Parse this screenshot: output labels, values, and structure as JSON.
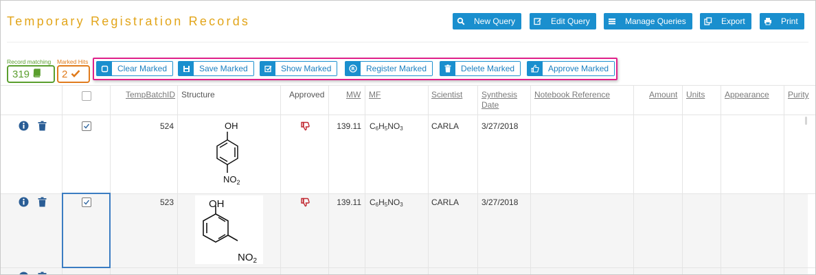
{
  "page": {
    "title": "Temporary Registration Records"
  },
  "toolbar": {
    "new_query": "New Query",
    "edit_query": "Edit Query",
    "manage_queries": "Manage Queries",
    "export": "Export",
    "print": "Print"
  },
  "summary": {
    "record_caption": "Record matching",
    "record_count": "319",
    "marked_caption": "Marked Hits",
    "marked_count": "2"
  },
  "marked_actions": {
    "clear": "Clear Marked",
    "save": "Save Marked",
    "show": "Show Marked",
    "register": "Register Marked",
    "delete": "Delete Marked",
    "approve": "Approve Marked"
  },
  "table": {
    "headers": {
      "temp_batch_id": "TempBatchID",
      "structure": "Structure",
      "approved": "Approved",
      "mw": "MW",
      "mf": "MF",
      "scientist": "Scientist",
      "synthesis_date_1": "Synthesis",
      "synthesis_date_2": "Date",
      "notebook_reference": "Notebook Reference",
      "amount": "Amount",
      "units": "Units",
      "appearance": "Appearance",
      "purity": "Purity"
    },
    "rows": [
      {
        "temp_batch_id": "524",
        "approved": "not-approved",
        "mw": "139.11",
        "mf_c": "C",
        "mf_c_n": "6",
        "mf_h": "H",
        "mf_h_n": "5",
        "mf_rest": "NO",
        "mf_o_n": "3",
        "scientist": "CARLA",
        "synthesis_date": "3/27/2018",
        "checked": true,
        "structure_oh": "OH",
        "structure_no2": "NO",
        "structure_no2_sub": "2"
      },
      {
        "temp_batch_id": "523",
        "approved": "not-approved",
        "mw": "139.11",
        "mf_c": "C",
        "mf_c_n": "6",
        "mf_h": "H",
        "mf_h_n": "5",
        "mf_rest": "NO",
        "mf_o_n": "3",
        "scientist": "CARLA",
        "synthesis_date": "3/27/2018",
        "checked": true,
        "structure_oh": "OH",
        "structure_no2": "NO",
        "structure_no2_sub": "2"
      }
    ]
  },
  "colors": {
    "accent": "#1a8fce",
    "title": "#e2a51a",
    "record": "#5a9e2d",
    "marked": "#e07b1c",
    "highlight": "#e0208a",
    "thumb_down": "#c0262f"
  }
}
